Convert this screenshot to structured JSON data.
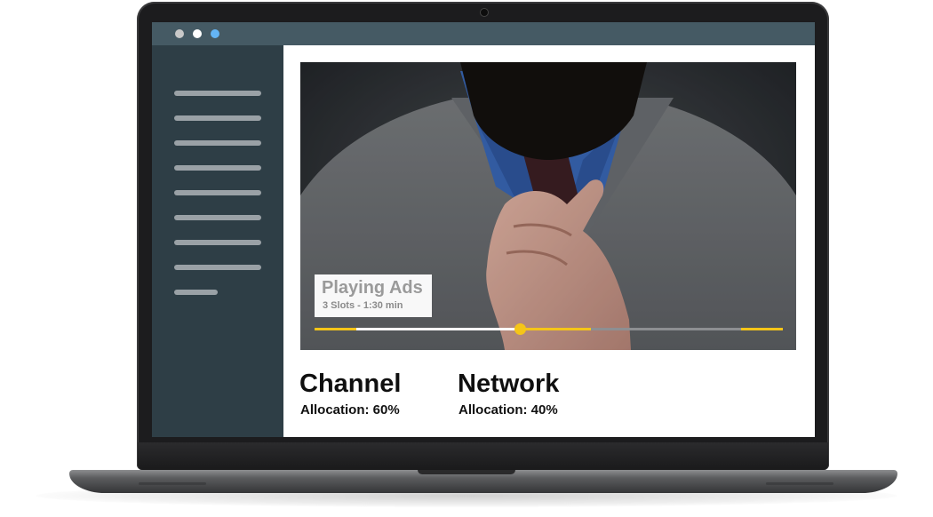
{
  "window": {
    "controls": [
      {
        "name": "close",
        "color": "#c9c9c9"
      },
      {
        "name": "minimize",
        "color": "#ffffff"
      },
      {
        "name": "zoom",
        "color": "#64b5f6"
      }
    ]
  },
  "sidebar": {
    "items": [
      "menu",
      "menu",
      "menu",
      "menu",
      "menu",
      "menu",
      "menu",
      "menu",
      "menu"
    ]
  },
  "player": {
    "overlay_title": "Playing Ads",
    "overlay_subtitle": "3 Slots - 1:30 min",
    "progress": 0.44,
    "ad_markers": [
      {
        "start": 0.0,
        "end": 0.09
      },
      {
        "start": 0.44,
        "end": 0.59
      },
      {
        "start": 0.91,
        "end": 1.0
      }
    ],
    "accent_color": "#f5c518"
  },
  "allocation": [
    {
      "name": "Channel",
      "label": "Allocation: 60%"
    },
    {
      "name": "Network",
      "label": "Allocation: 40%"
    }
  ]
}
